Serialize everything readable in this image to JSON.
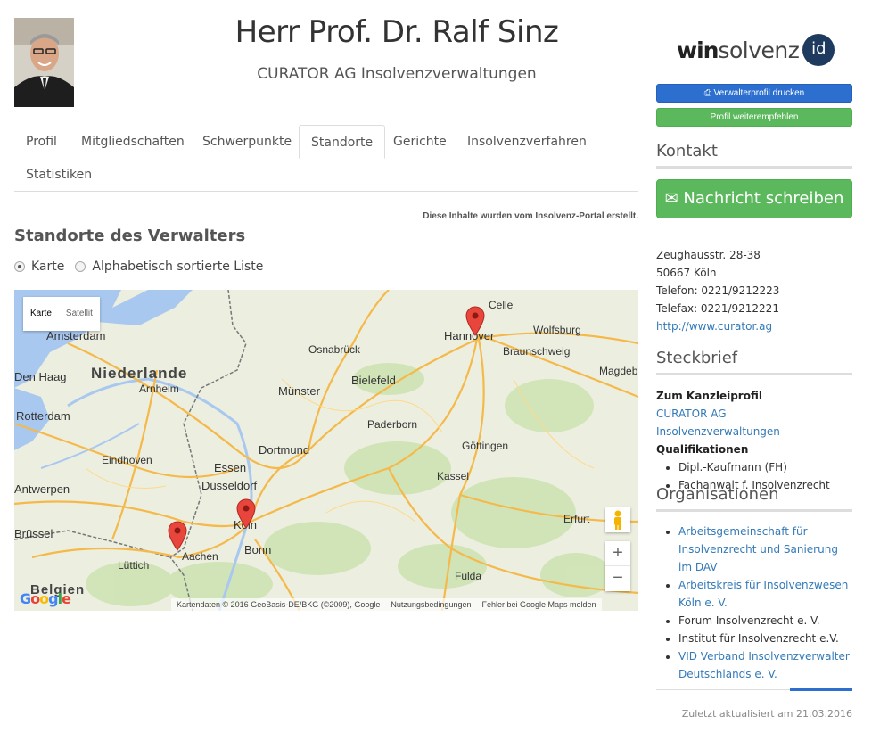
{
  "header": {
    "name": "Herr Prof. Dr. Ralf Sinz",
    "company": "CURATOR AG Insolvenzverwaltungen"
  },
  "tabs": [
    {
      "label": "Profil"
    },
    {
      "label": "Mitgliedschaften"
    },
    {
      "label": "Schwerpunkte"
    },
    {
      "label": "Standorte",
      "active": true
    },
    {
      "label": "Gerichte"
    },
    {
      "label": "Insolvenzverfahren"
    },
    {
      "label": "Statistiken"
    }
  ],
  "note": "Diese Inhalte wurden vom Insolvenz-Portal erstellt.",
  "section_title": "Standorte des Verwalters",
  "view_options": {
    "map_label": "Karte",
    "list_label": "Alphabetisch sortierte Liste",
    "selected": "Karte"
  },
  "map": {
    "type_map": "Karte",
    "type_satellite": "Satellit",
    "zoom_in": "+",
    "zoom_out": "−",
    "google_logo": "Google",
    "attribution": "Kartendaten © 2016 GeoBasis-DE/BKG (©2009), Google",
    "terms": "Nutzungsbedingungen",
    "report": "Fehler bei Google Maps melden",
    "cities": [
      "Amsterdam",
      "Den Haag",
      "Rotterdam",
      "Niederlande",
      "Arnheim",
      "Eindhoven",
      "Antwerpen",
      "Brüssel",
      "Belgien",
      "Lüttich",
      "Aachen",
      "Köln",
      "Bonn",
      "Düsseldorf",
      "Essen",
      "Dortmund",
      "Münster",
      "Osnabrück",
      "Bielefeld",
      "Paderborn",
      "Hannover",
      "Celle",
      "Wolfsburg",
      "Braunschweig",
      "Magdeburg",
      "Göttingen",
      "Kassel",
      "Erfurt",
      "Fulda"
    ],
    "markers": [
      "Hannover",
      "Köln",
      "Aachen"
    ]
  },
  "sidebar": {
    "brand_bold": "win",
    "brand_light": "solvenz",
    "brand_badge": "id",
    "print_button": "Verwalterprofil drucken",
    "recommend_button": "Profil weiterempfehlen",
    "contact_title": "Kontakt",
    "message_button": "Nachricht schreiben",
    "address_street": "Zeughausstr. 28-38",
    "address_city": "50667 Köln",
    "phone": "Telefon: 0221/9212223",
    "fax": "Telefax: 0221/9212221",
    "website": "http://www.curator.ag",
    "profile_title": "Steckbrief",
    "office_label": "Zum Kanzleiprofil",
    "office_link": "CURATOR AG Insolvenzverwaltungen",
    "qualifications_label": "Qualifikationen",
    "qualifications": [
      "Dipl.-Kaufmann (FH)",
      "Fachanwalt f. Insolvenzrecht"
    ],
    "organisations_title": "Organisationen",
    "organisations": [
      {
        "label": "Arbeitsgemeinschaft für Insolvenzrecht und Sanierung im DAV",
        "link": true
      },
      {
        "label": "Arbeitskreis für Insolvenzwesen Köln e. V.",
        "link": true
      },
      {
        "label": "Forum Insolvenzrecht e. V.",
        "link": false
      },
      {
        "label": "Institut für Insolvenzrecht e.V.",
        "link": false
      },
      {
        "label": "VID Verband Insolvenzverwalter Deutschlands e. V.",
        "link": true
      }
    ],
    "updated": "Zuletzt aktualisiert am 21.03.2016"
  },
  "colors": {
    "primary": "#2c6fcf",
    "success": "#5cb85c",
    "link": "#337ab7",
    "marker": "#e8453c"
  }
}
